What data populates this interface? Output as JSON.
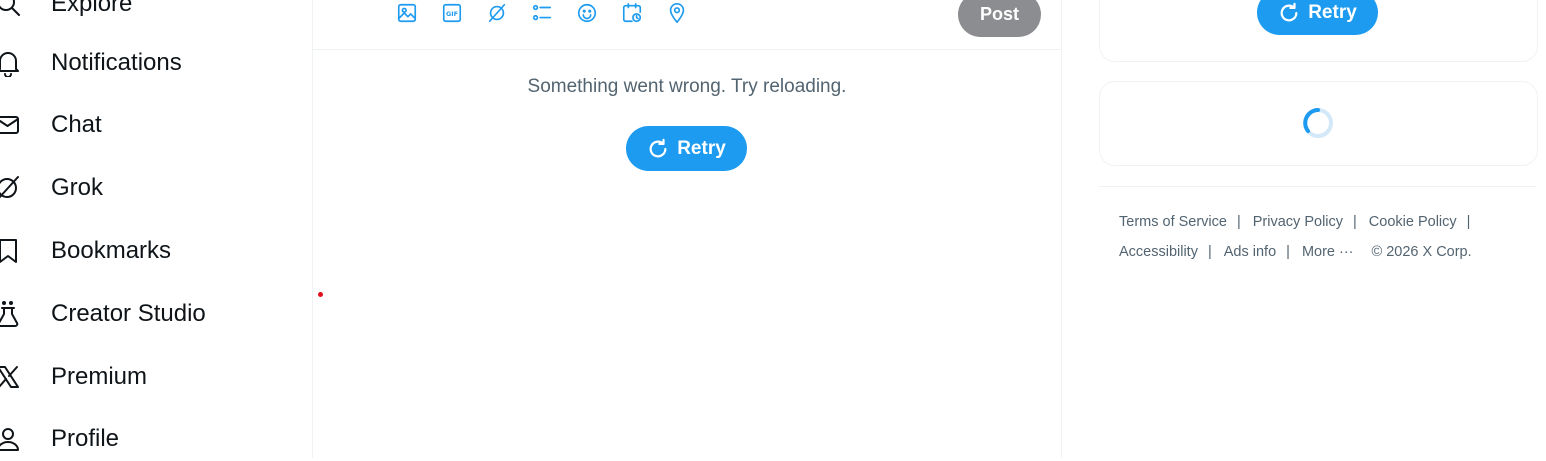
{
  "nav": {
    "items": [
      {
        "label": "Explore",
        "icon": "search-icon"
      },
      {
        "label": "Notifications",
        "icon": "bell-icon"
      },
      {
        "label": "Chat",
        "icon": "envelope-icon"
      },
      {
        "label": "Grok",
        "icon": "grok-icon"
      },
      {
        "label": "Bookmarks",
        "icon": "bookmark-icon"
      },
      {
        "label": "Creator Studio",
        "icon": "flask-icon"
      },
      {
        "label": "Premium",
        "icon": "x-logo-icon"
      },
      {
        "label": "Profile",
        "icon": "person-icon"
      }
    ]
  },
  "compose": {
    "tools": [
      "image-icon",
      "gif-icon",
      "grok-icon",
      "poll-icon",
      "emoji-icon",
      "schedule-icon",
      "location-icon"
    ],
    "post_label": "Post"
  },
  "feed": {
    "error_text": "Something went wrong. Try reloading.",
    "retry_label": "Retry"
  },
  "sidebar": {
    "retry_label": "Retry",
    "loading": true
  },
  "footer": {
    "terms": "Terms of Service",
    "privacy": "Privacy Policy",
    "cookie": "Cookie Policy",
    "accessibility": "Accessibility",
    "ads_info": "Ads info",
    "more": "More ···",
    "copyright": "© 2026 X Corp."
  },
  "colors": {
    "accent": "#1d9bf0",
    "post_disabled": "#8b8d90",
    "muted_text": "#536471",
    "border": "#eff3f4"
  }
}
